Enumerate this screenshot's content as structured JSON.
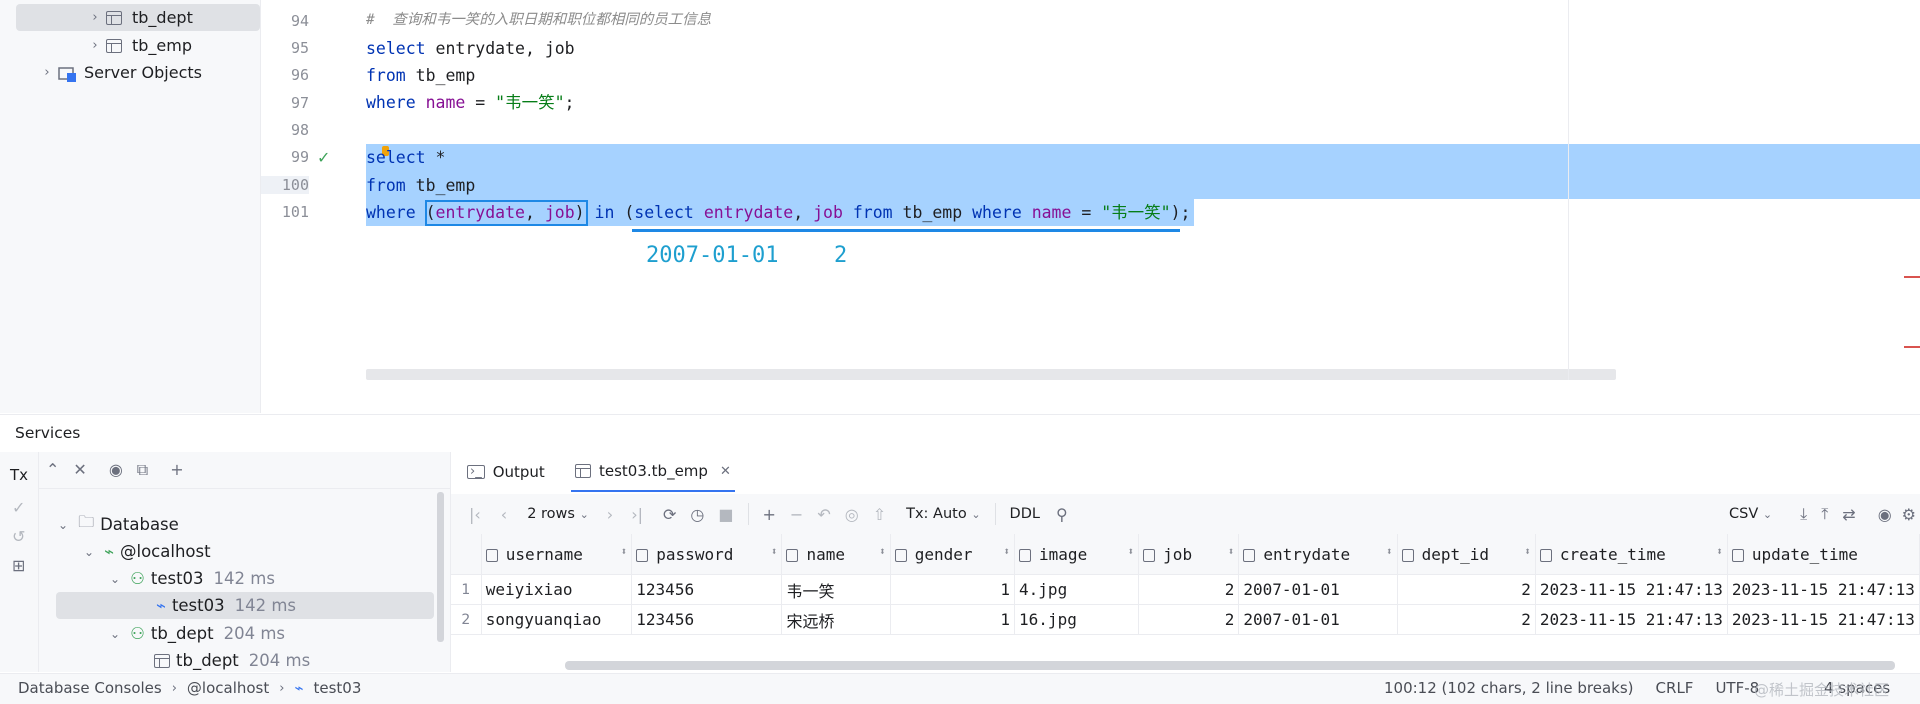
{
  "tree": {
    "items": [
      {
        "label": "tb_dept",
        "icon": "table-icon"
      },
      {
        "label": "tb_emp",
        "icon": "table-icon"
      },
      {
        "label": "Server Objects",
        "icon": "server-objects-icon"
      }
    ]
  },
  "editor": {
    "line_numbers": [
      "94",
      "95",
      "96",
      "97",
      "98",
      "99",
      "100",
      "101"
    ],
    "comment": "#  查询和韦一笑的入职日期和职位都相同的员工信息",
    "l95": {
      "kw": "select",
      "rest": " entrydate, job"
    },
    "l96": {
      "kw": "from",
      "rest": " tb_emp"
    },
    "l97": {
      "kw": "where",
      "id": " name",
      "op": " = ",
      "str": "\"韦一笑\"",
      "end": ";"
    },
    "l99": {
      "kw": "select",
      "rest": " *"
    },
    "l100": {
      "kw": "from",
      "rest": " tb_emp"
    },
    "l101": {
      "t1": "where",
      "t2": " (",
      "t3": "entrydate",
      "t4": ", ",
      "t5": "job",
      "t6": ")",
      "t7": " in ",
      "t8": "(",
      "t9": "select",
      "t10": " ",
      "t11": "entrydate",
      "t12": ", ",
      "t13": "job",
      "t14": " ",
      "t15": "from",
      "t16": " tb_emp ",
      "t17": "where",
      "t18": " ",
      "t19": "name",
      "t20": " = ",
      "t21": "\"韦一笑\"",
      "t22": ");"
    },
    "inline_result": {
      "date": "2007-01-01",
      "job": "2"
    }
  },
  "services": {
    "title": "Services",
    "tx_label": "Tx",
    "tree": [
      {
        "label": "Database",
        "time": ""
      },
      {
        "label": "@localhost",
        "time": ""
      },
      {
        "label": "test03",
        "time": "142 ms"
      },
      {
        "label": "test03",
        "time": "142 ms"
      },
      {
        "label": "tb_dept",
        "time": "204 ms"
      },
      {
        "label": "tb_dept",
        "time": "204 ms"
      }
    ]
  },
  "results": {
    "tabs": [
      {
        "label": "Output"
      },
      {
        "label": "test03.tb_emp"
      }
    ],
    "toolbar": {
      "rows": "2 rows",
      "tx": "Tx: Auto",
      "ddl": "DDL",
      "export": "CSV"
    },
    "columns": [
      "username",
      "password",
      "name",
      "gender",
      "image",
      "job",
      "entrydate",
      "dept_id",
      "create_time",
      "update_time"
    ],
    "rows": [
      {
        "n": "1",
        "username": "weiyixiao",
        "password": "123456",
        "name": "韦一笑",
        "gender": "1",
        "image": "4.jpg",
        "job": "2",
        "entrydate": "2007-01-01",
        "dept_id": "2",
        "create_time": "2023-11-15 21:47:13",
        "update_time": "2023-11-15 21:47:13"
      },
      {
        "n": "2",
        "username": "songyuanqiao",
        "password": "123456",
        "name": "宋远桥",
        "gender": "1",
        "image": "16.jpg",
        "job": "2",
        "entrydate": "2007-01-01",
        "dept_id": "2",
        "create_time": "2023-11-15 21:47:13",
        "update_time": "2023-11-15 21:47:13"
      }
    ]
  },
  "statusbar": {
    "crumbs": [
      "Database Consoles",
      "@localhost",
      "test03"
    ],
    "position": "100:12 (102 chars, 2 line breaks)",
    "line_sep": "CRLF",
    "encoding": "UTF-8",
    "indent": "4 spaces",
    "watermark": "@稀土掘金技术社区"
  },
  "colors": {
    "selection": "#a6d2ff",
    "keyword": "#0033b3",
    "identifier": "#871094",
    "string": "#067d17",
    "highlight_box": "#1e88e5"
  }
}
